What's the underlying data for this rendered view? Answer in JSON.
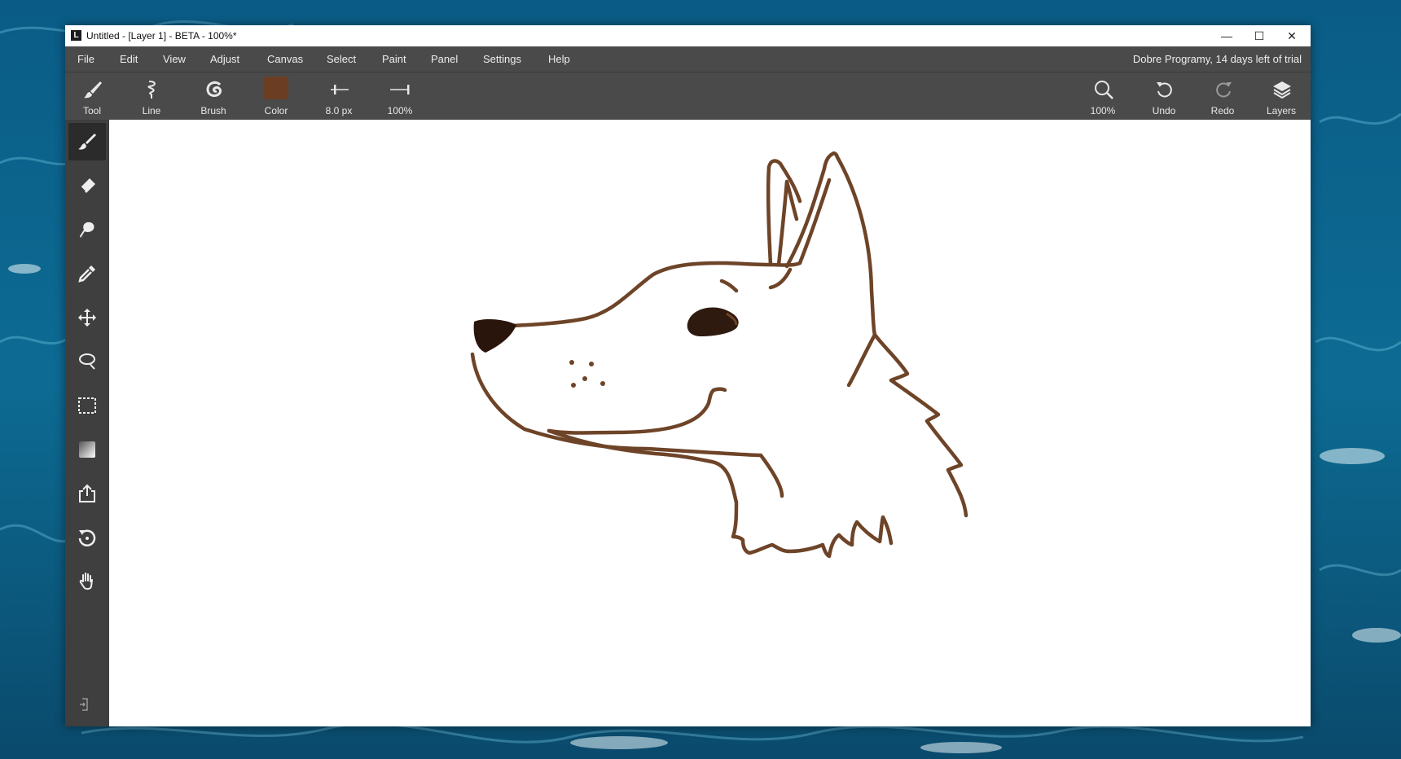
{
  "window": {
    "title": "Untitled - [Layer 1] - BETA - 100%*",
    "logo_letter": "L",
    "minimize_glyph": "—",
    "maximize_glyph": "☐",
    "close_glyph": "✕"
  },
  "menu": {
    "items": [
      "File",
      "Edit",
      "View",
      "Adjust",
      "Canvas",
      "Select",
      "Paint",
      "Panel",
      "Settings",
      "Help"
    ],
    "trial_text": "Dobre Programy, 14 days left of trial"
  },
  "toolbar": {
    "tool_label": "Tool",
    "line_label": "Line",
    "brush_label": "Brush",
    "color_label": "Color",
    "size_label": "8.0 px",
    "opacity_label": "100%",
    "zoom_label": "100%",
    "undo_label": "Undo",
    "redo_label": "Redo",
    "layers_label": "Layers"
  },
  "colors": {
    "brush_color": "#6b3e23",
    "stroke_color": "#6e4428",
    "nose_color": "#2a150c",
    "ui_dark": "#4a4a4a"
  },
  "tools": {
    "icons": [
      "brush-icon",
      "eraser-icon",
      "smudge-icon",
      "eyedropper-icon",
      "move-icon",
      "lasso-icon",
      "marquee-select-icon",
      "gradient-icon",
      "export-icon",
      "rotate-icon",
      "hand-icon"
    ],
    "active": "brush-icon"
  }
}
